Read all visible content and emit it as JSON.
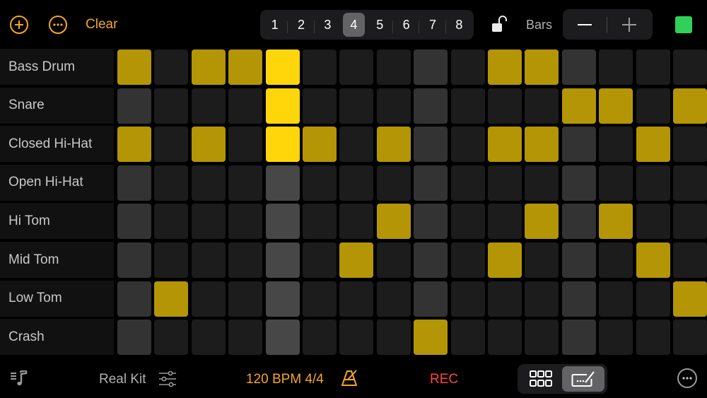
{
  "toolbar": {
    "add_icon": "plus-circle-icon",
    "more_icon": "ellipsis-circle-icon",
    "clear_label": "Clear",
    "bar_selector": {
      "bars": [
        "1",
        "2",
        "3",
        "4",
        "5",
        "6",
        "7",
        "8"
      ],
      "selected": "4"
    },
    "lock_icon": "unlock-icon",
    "bars_label": "Bars",
    "minus_icon": "minus-icon",
    "plus_icon": "plus-icon",
    "color_swatch": "#30d158"
  },
  "grid": {
    "steps": 16,
    "playhead_step": 4,
    "beat_steps": [
      0,
      4,
      8,
      12
    ],
    "active_color": "#b49506",
    "playhead_active_color": "#ffd60a",
    "tracks": [
      {
        "name": "Bass Drum",
        "active": [
          0,
          2,
          3,
          4,
          10,
          11
        ]
      },
      {
        "name": "Snare",
        "active": [
          4,
          12,
          13,
          15
        ]
      },
      {
        "name": "Closed Hi-Hat",
        "active": [
          0,
          2,
          4,
          5,
          7,
          10,
          11,
          14
        ]
      },
      {
        "name": "Open Hi-Hat",
        "active": []
      },
      {
        "name": "Hi Tom",
        "active": [
          7,
          11,
          13
        ]
      },
      {
        "name": "Mid Tom",
        "active": [
          6,
          10,
          14
        ]
      },
      {
        "name": "Low Tom",
        "active": [
          1,
          15
        ]
      },
      {
        "name": "Crash",
        "active": [
          8
        ]
      }
    ]
  },
  "bottom": {
    "library_icon": "music-list-icon",
    "kit_name": "Real Kit",
    "kit_settings_icon": "sliders-icon",
    "tempo": "120 BPM 4/4",
    "metronome_icon": "metronome-icon",
    "rec_label": "REC",
    "view_modes": [
      {
        "name": "grid-view",
        "icon": "grid-icon",
        "selected": false
      },
      {
        "name": "edit-view",
        "icon": "keyboard-edit-icon",
        "selected": true
      }
    ],
    "more_icon": "ellipsis-circle-icon"
  }
}
